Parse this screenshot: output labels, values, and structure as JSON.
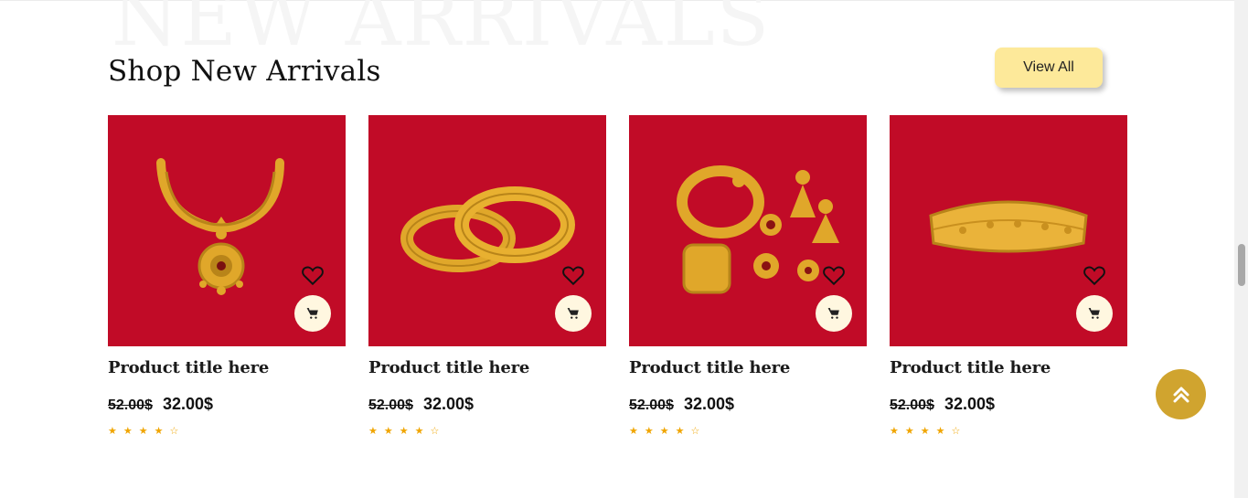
{
  "section": {
    "background_word": "NEW ARRIVALS",
    "title": "Shop New Arrivals",
    "view_all_label": "View All"
  },
  "products": [
    {
      "title": "Product title here",
      "old_price": "52.00$",
      "price": "32.00$",
      "rating": 4,
      "max_rating": 5,
      "image": "necklace"
    },
    {
      "title": "Product title here",
      "old_price": "52.00$",
      "price": "32.00$",
      "rating": 4,
      "max_rating": 5,
      "image": "bangles"
    },
    {
      "title": "Product title here",
      "old_price": "52.00$",
      "price": "32.00$",
      "rating": 4,
      "max_rating": 5,
      "image": "jewelry-set"
    },
    {
      "title": "Product title here",
      "old_price": "52.00$",
      "price": "32.00$",
      "rating": 4,
      "max_rating": 5,
      "image": "armlet"
    }
  ],
  "icons": {
    "wishlist": "heart-icon",
    "cart": "cart-icon",
    "scroll_top": "double-chevron-up-icon"
  },
  "colors": {
    "card_background": "#c10b27",
    "view_all_background": "#fde99a",
    "scroll_top_background": "#d0a42f",
    "star": "#f0a500",
    "gold": "#e0a72a"
  }
}
